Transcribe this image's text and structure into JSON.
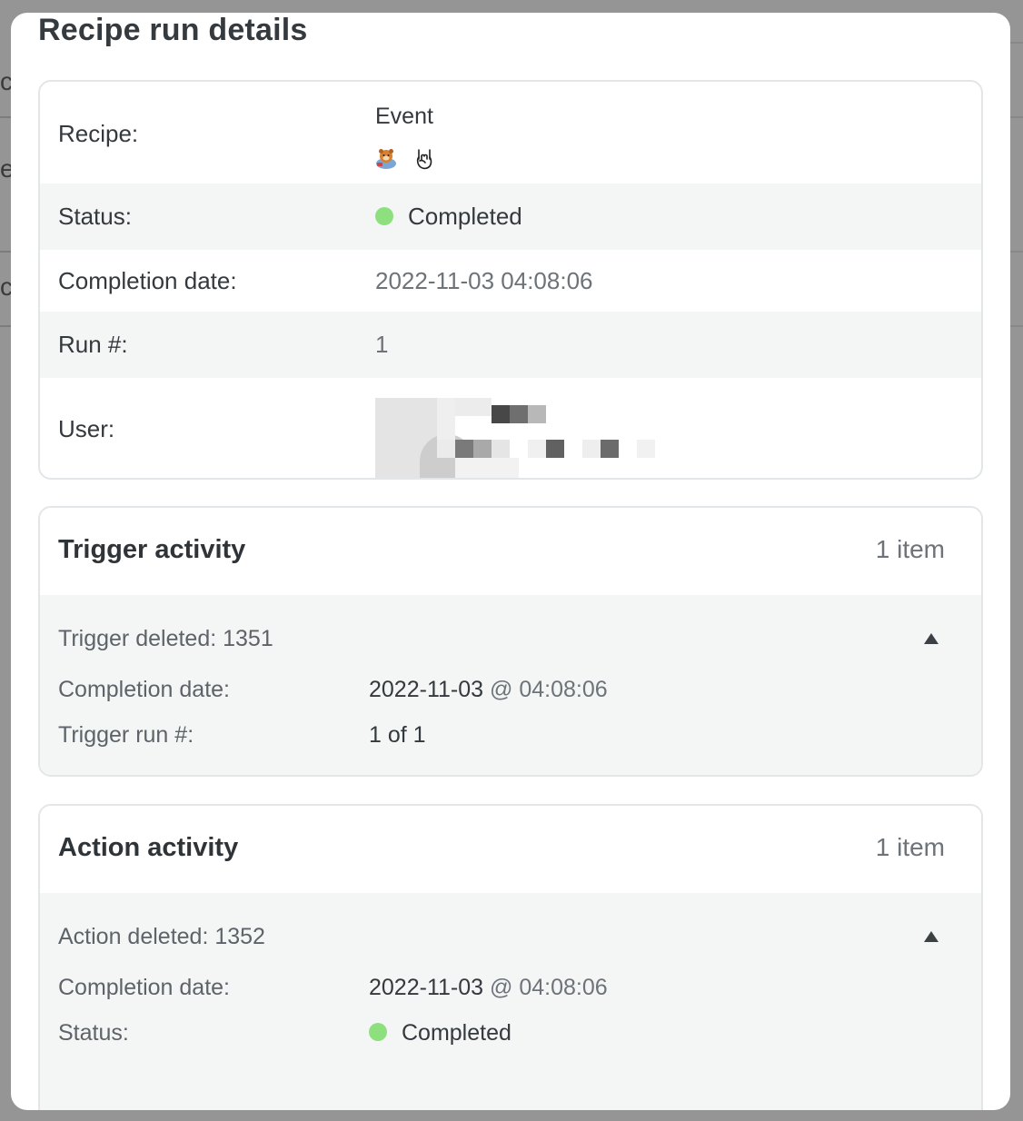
{
  "modal": {
    "title": "Recipe run details"
  },
  "details": {
    "recipe_label": "Recipe:",
    "recipe_name": "Event",
    "recipe_icons": [
      "bear-mascot-icon",
      "rock-hand-icon"
    ],
    "status_label": "Status:",
    "status_value": "Completed",
    "completion_label": "Completion date:",
    "completion_value": "2022-11-03 04:08:06",
    "run_label": "Run #:",
    "run_value": "1",
    "user_label": "User:"
  },
  "trigger": {
    "title": "Trigger activity",
    "count": "1 item",
    "item_title": "Trigger deleted: 1351",
    "completion_label": "Completion date:",
    "completion_date": "2022-11-03",
    "at": "@",
    "completion_time": "04:08:06",
    "run_label": "Trigger run #:",
    "run_value": "1 of 1"
  },
  "action": {
    "title": "Action activity",
    "count": "1 item",
    "item_title": "Action deleted: 1352",
    "completion_label": "Completion date:",
    "completion_date": "2022-11-03",
    "at": "@",
    "completion_time": "04:08:06",
    "status_label": "Status:",
    "status_value": "Completed"
  },
  "colors": {
    "status_completed": "#8ee07f",
    "backdrop": "#959595"
  }
}
